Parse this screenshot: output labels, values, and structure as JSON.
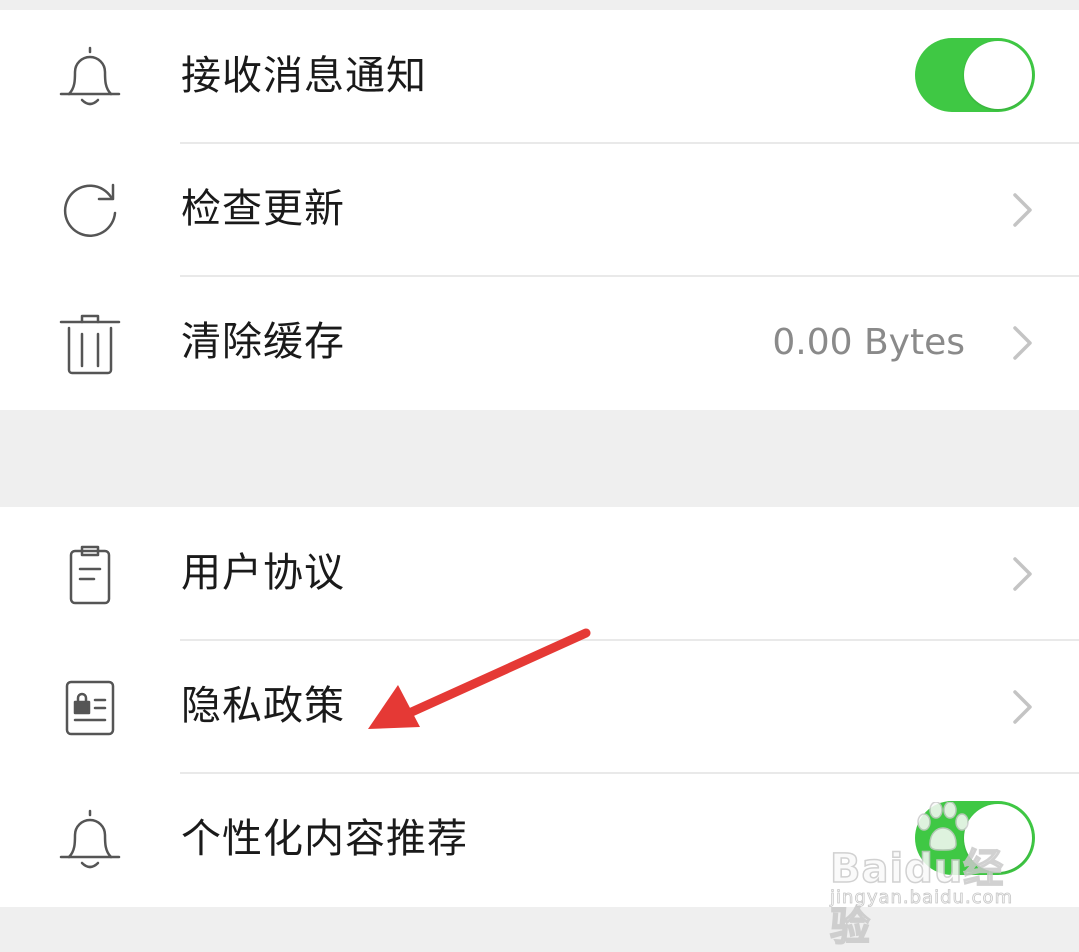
{
  "settings": {
    "group1": [
      {
        "label": "接收消息通知",
        "icon": "bell-icon",
        "control": "toggle",
        "on": true
      },
      {
        "label": "检查更新",
        "icon": "refresh-icon",
        "control": "chevron"
      },
      {
        "label": "清除缓存",
        "icon": "trash-icon",
        "control": "chevron",
        "value": "0.00 Bytes"
      }
    ],
    "group2": [
      {
        "label": "用户协议",
        "icon": "clipboard-icon",
        "control": "chevron"
      },
      {
        "label": "隐私政策",
        "icon": "privacy-document-icon",
        "control": "chevron"
      },
      {
        "label": "个性化内容推荐",
        "icon": "bell-icon",
        "control": "toggle",
        "on": true
      }
    ]
  },
  "colors": {
    "toggle_on": "#3fc844",
    "annotation_arrow": "#e53935",
    "icon_stroke": "#555555"
  },
  "watermark": {
    "brand": "Baidu经验",
    "url": "jingyan.baidu.com"
  }
}
